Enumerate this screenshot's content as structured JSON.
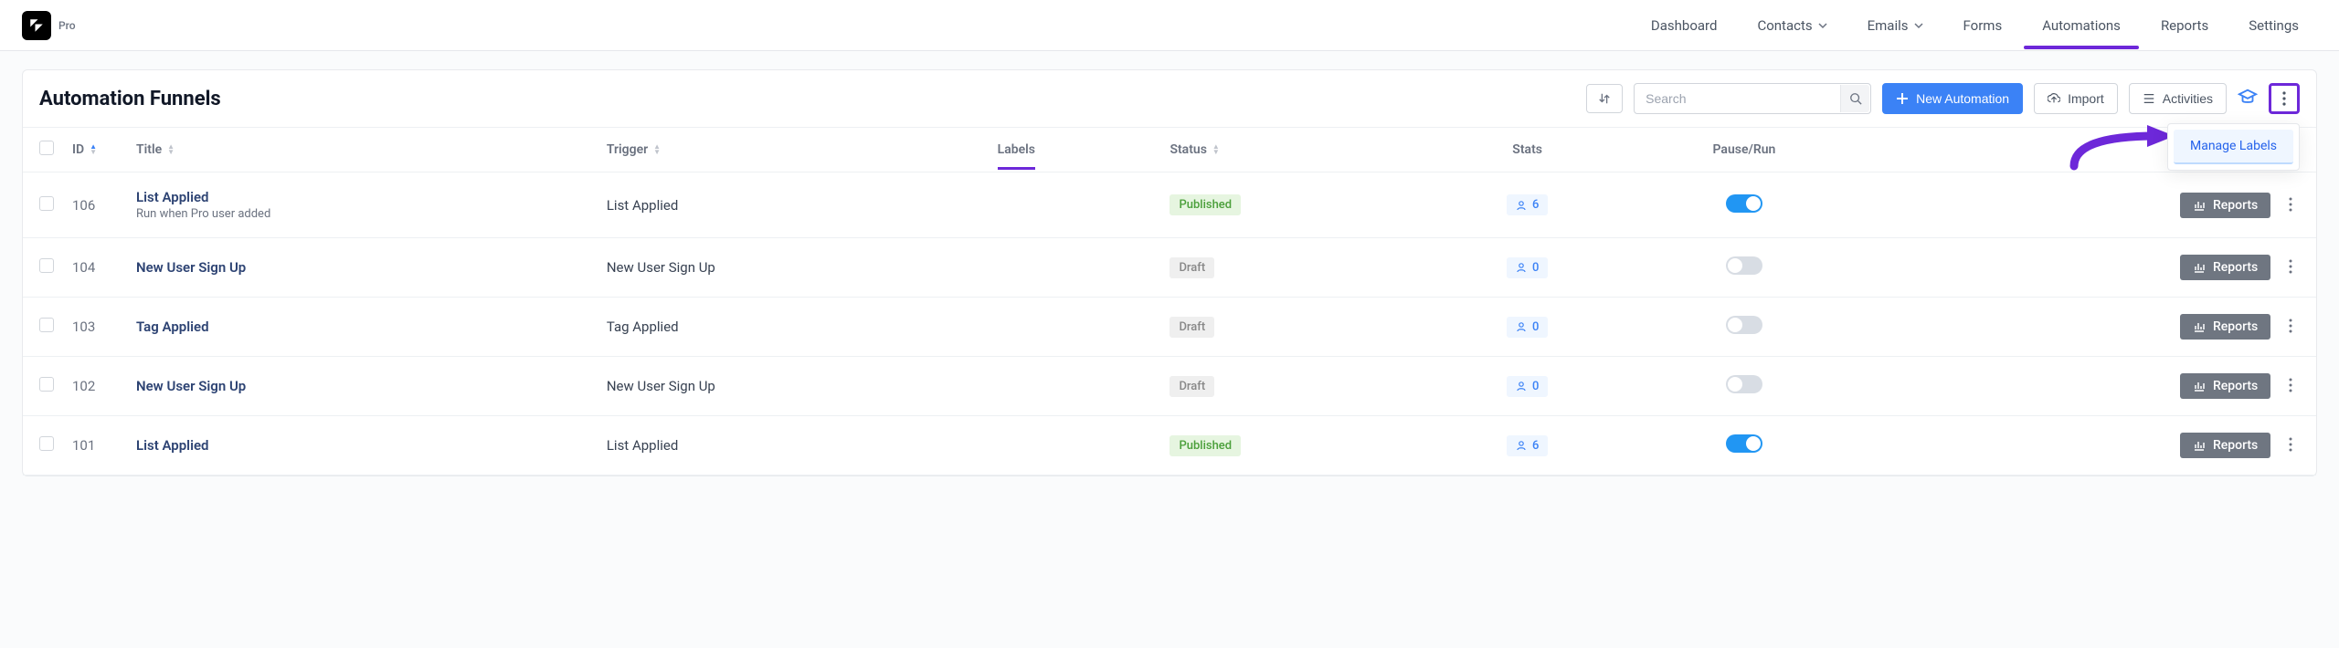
{
  "brand": {
    "pro_label": "Pro"
  },
  "nav": {
    "dashboard": "Dashboard",
    "contacts": "Contacts",
    "emails": "Emails",
    "forms": "Forms",
    "automations": "Automations",
    "reports": "Reports",
    "settings": "Settings"
  },
  "toolbar": {
    "title": "Automation Funnels",
    "search_placeholder": "Search",
    "new_automation": "New Automation",
    "import": "Import",
    "activities": "Activities"
  },
  "dropdown": {
    "manage_labels": "Manage Labels"
  },
  "columns": {
    "id": "ID",
    "title": "Title",
    "trigger": "Trigger",
    "labels": "Labels",
    "status": "Status",
    "stats": "Stats",
    "pause_run": "Pause/Run"
  },
  "status_labels": {
    "published": "Published",
    "draft": "Draft"
  },
  "row_actions": {
    "reports": "Reports"
  },
  "rows": [
    {
      "id": "106",
      "title": "List Applied",
      "subtitle": "Run when Pro user added",
      "trigger": "List Applied",
      "status": "published",
      "count": "6",
      "running": true
    },
    {
      "id": "104",
      "title": "New User Sign Up",
      "subtitle": "",
      "trigger": "New User Sign Up",
      "status": "draft",
      "count": "0",
      "running": false
    },
    {
      "id": "103",
      "title": "Tag Applied",
      "subtitle": "",
      "trigger": "Tag Applied",
      "status": "draft",
      "count": "0",
      "running": false
    },
    {
      "id": "102",
      "title": "New User Sign Up",
      "subtitle": "",
      "trigger": "New User Sign Up",
      "status": "draft",
      "count": "0",
      "running": false
    },
    {
      "id": "101",
      "title": "List Applied",
      "subtitle": "",
      "trigger": "List Applied",
      "status": "published",
      "count": "6",
      "running": true
    }
  ],
  "colors": {
    "accent_purple": "#6d28d9",
    "primary_blue": "#3b82f6"
  }
}
